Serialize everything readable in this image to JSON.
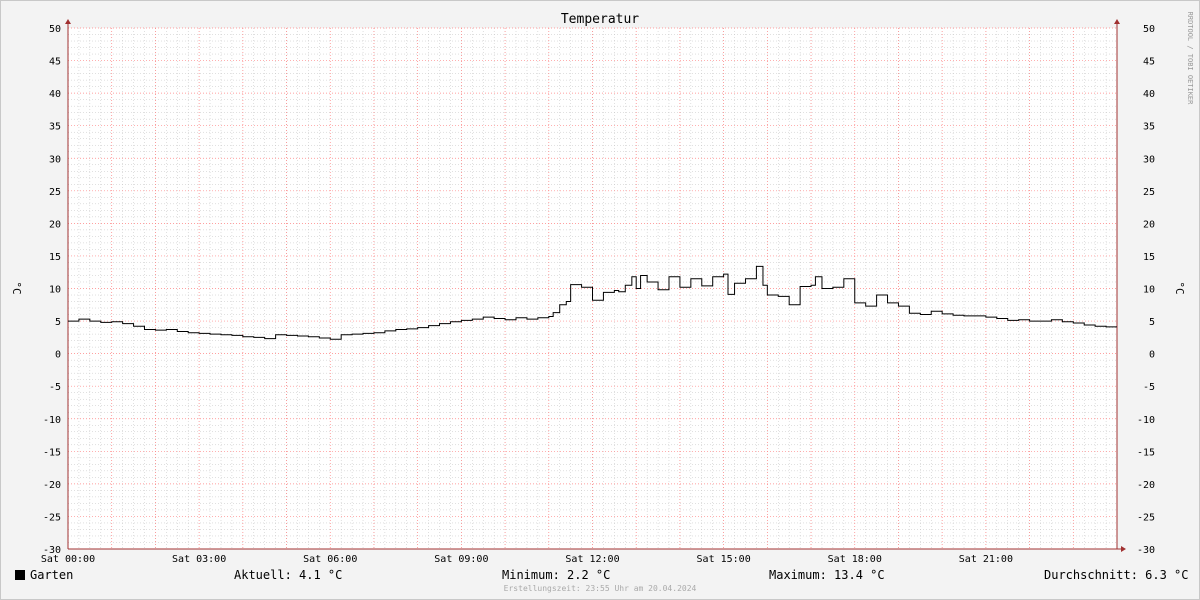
{
  "chart_data": {
    "type": "line",
    "title": "Temperatur",
    "ylabel": "°C",
    "ylim": [
      -30,
      50
    ],
    "yticks": [
      -30,
      -25,
      -20,
      -15,
      -10,
      -5,
      0,
      5,
      10,
      15,
      20,
      25,
      30,
      35,
      40,
      45,
      50
    ],
    "xlim_hours": [
      0,
      24
    ],
    "xtick_labels": [
      "Sat 00:00",
      "Sat 03:00",
      "Sat 06:00",
      "Sat 09:00",
      "Sat 12:00",
      "Sat 15:00",
      "Sat 18:00",
      "Sat 21:00"
    ],
    "grid": true,
    "series": [
      {
        "name": "Garten",
        "color": "#000000",
        "x_hours": [
          0,
          0.25,
          0.5,
          0.75,
          1.0,
          1.25,
          1.5,
          1.75,
          2.0,
          2.25,
          2.5,
          2.75,
          3.0,
          3.25,
          3.5,
          3.75,
          4.0,
          4.25,
          4.5,
          4.75,
          5.0,
          5.25,
          5.5,
          5.75,
          6.0,
          6.25,
          6.5,
          6.75,
          7.0,
          7.25,
          7.5,
          7.75,
          8.0,
          8.25,
          8.5,
          8.75,
          9.0,
          9.25,
          9.5,
          9.75,
          10.0,
          10.25,
          10.5,
          10.75,
          11.0,
          11.1,
          11.25,
          11.4,
          11.5,
          11.75,
          12.0,
          12.25,
          12.5,
          12.6,
          12.75,
          12.9,
          13.0,
          13.1,
          13.25,
          13.5,
          13.75,
          14.0,
          14.25,
          14.5,
          14.75,
          15.0,
          15.1,
          15.25,
          15.5,
          15.75,
          15.9,
          16.0,
          16.25,
          16.5,
          16.75,
          17.0,
          17.1,
          17.25,
          17.5,
          17.75,
          18.0,
          18.25,
          18.5,
          18.75,
          19.0,
          19.25,
          19.5,
          19.75,
          20.0,
          20.25,
          20.5,
          20.75,
          21.0,
          21.25,
          21.5,
          21.75,
          22.0,
          22.25,
          22.5,
          22.75,
          23.0,
          23.25,
          23.5,
          23.75,
          24.0
        ],
        "values": [
          5.0,
          5.3,
          5.0,
          4.8,
          4.9,
          4.6,
          4.2,
          3.7,
          3.6,
          3.7,
          3.4,
          3.2,
          3.1,
          3.0,
          2.9,
          2.8,
          2.6,
          2.5,
          2.3,
          2.9,
          2.8,
          2.7,
          2.6,
          2.4,
          2.2,
          2.9,
          3.0,
          3.1,
          3.2,
          3.5,
          3.7,
          3.8,
          4.0,
          4.3,
          4.6,
          4.9,
          5.1,
          5.3,
          5.6,
          5.4,
          5.2,
          5.5,
          5.3,
          5.5,
          5.7,
          6.3,
          7.5,
          8.0,
          10.6,
          10.2,
          8.2,
          9.4,
          9.7,
          9.5,
          10.5,
          11.8,
          10.0,
          12.0,
          11.0,
          9.8,
          11.8,
          10.2,
          11.5,
          10.4,
          11.8,
          12.2,
          9.1,
          10.8,
          11.5,
          13.4,
          10.5,
          9.0,
          8.8,
          7.5,
          10.3,
          10.5,
          11.8,
          10.0,
          10.2,
          11.5,
          7.8,
          7.3,
          9.0,
          7.8,
          7.3,
          6.2,
          6.0,
          6.5,
          6.1,
          5.9,
          5.8,
          5.8,
          5.6,
          5.4,
          5.1,
          5.2,
          5.0,
          5.0,
          5.2,
          4.9,
          4.7,
          4.4,
          4.2,
          4.1,
          4.1
        ]
      }
    ],
    "legend": {
      "series_name": "Garten",
      "aktuell": "Aktuell: 4.1 °C",
      "minimum": "Minimum: 2.2 °C",
      "maximum": "Maximum: 13.4 °C",
      "durchschnitt": "Durchschnitt: 6.3 °C"
    },
    "footer": "Erstellungszeit: 23:55 Uhr am 20.04.2024",
    "watermark": "RRDTOOL / TOBI OETIKER",
    "colors": {
      "background": "#f3f3f3",
      "plot_bg": "#ffffff",
      "major_grid": "#ff8080",
      "minor_grid": "#c0c0c0",
      "axis": "#a03030",
      "line": "#000000"
    }
  }
}
